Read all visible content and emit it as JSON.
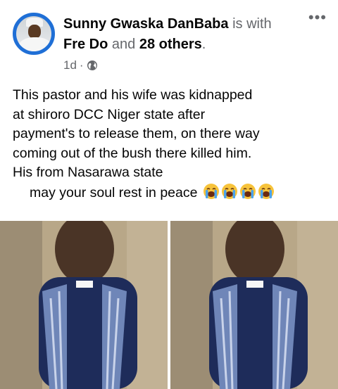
{
  "post": {
    "author": "Sunny Gwaska DanBaba",
    "is_with": "is with",
    "tagged_1": "Fre Do",
    "and": "and",
    "tagged_2": "28 others",
    "time": "1d",
    "privacy_icon": "globe-icon",
    "more_icon": "more-options-icon",
    "text_lines": [
      "This pastor and his wife was kidnapped",
      "at shiroro DCC Niger state after",
      "payment's to release them, on there way",
      "coming out of the bush there killed him.",
      "His from Nasarawa state",
      "may your soul rest in peace"
    ],
    "emoji": [
      "loudly-crying-face",
      "loudly-crying-face",
      "loudly-crying-face",
      "loudly-crying-face"
    ]
  },
  "colors": {
    "avatar_ring": "#1f6fd6",
    "meta_text": "#65676b",
    "scarf_blue": "#6f86b8",
    "sweater": "#1e2c5a"
  }
}
